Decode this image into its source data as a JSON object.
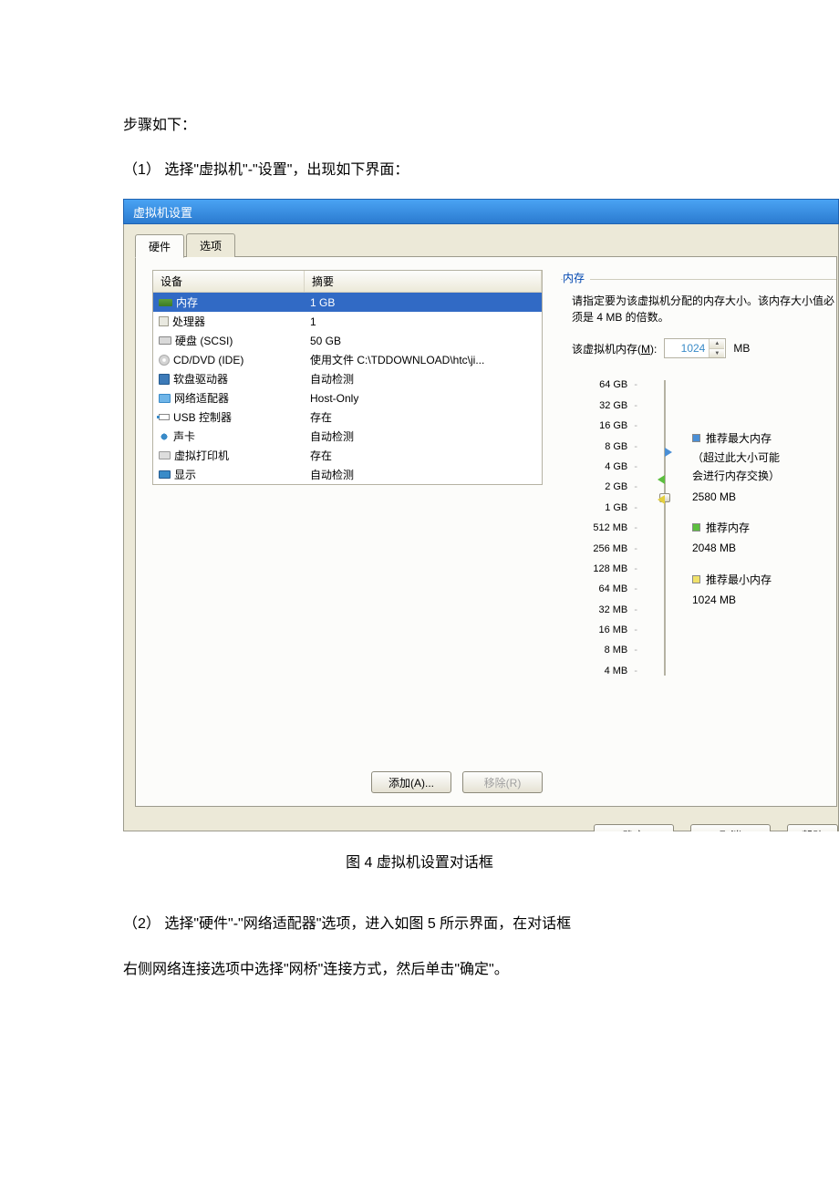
{
  "doc": {
    "line0": "步骤如下：",
    "line1": "（1） 选择\"虚拟机\"-\"设置\"，出现如下界面：",
    "caption": "图 4  虚拟机设置对话框",
    "line2": "（2） 选择\"硬件\"-\"网络适配器\"选项，进入如图 5 所示界面，在对话框",
    "line3": "右侧网络连接选项中选择\"网桥\"连接方式，然后单击\"确定\"。"
  },
  "dialog": {
    "title": "虚拟机设置",
    "tabs": {
      "hardware": "硬件",
      "options": "选项"
    },
    "columns": {
      "device": "设备",
      "summary": "摘要"
    },
    "rows": [
      {
        "icon": "mem",
        "device": "内存",
        "summary": "1 GB",
        "selected": true
      },
      {
        "icon": "cpu",
        "device": "处理器",
        "summary": "1"
      },
      {
        "icon": "hdd",
        "device": "硬盘 (SCSI)",
        "summary": "50 GB"
      },
      {
        "icon": "cd",
        "device": "CD/DVD (IDE)",
        "summary": "使用文件 C:\\TDDOWNLOAD\\htc\\ji..."
      },
      {
        "icon": "floppy",
        "device": "软盘驱动器",
        "summary": "自动检测"
      },
      {
        "icon": "net",
        "device": "网络适配器",
        "summary": "Host-Only"
      },
      {
        "icon": "usb",
        "device": "USB 控制器",
        "summary": "存在"
      },
      {
        "icon": "sound",
        "device": "声卡",
        "summary": "自动检测"
      },
      {
        "icon": "printer",
        "device": "虚拟打印机",
        "summary": "存在"
      },
      {
        "icon": "display",
        "device": "显示",
        "summary": "自动检测"
      }
    ],
    "buttons": {
      "add": "添加(A)...",
      "remove": "移除(R)",
      "ok": "确定",
      "cancel": "取消",
      "help": "帮助"
    },
    "memory": {
      "group_title": "内存",
      "desc": "请指定要为该虚拟机分配的内存大小。该内存大小值必须是 4 MB 的倍数。",
      "label_prefix": "该虚拟机内存(",
      "label_mnemonic": "M",
      "label_suffix": "):",
      "value": "1024",
      "unit": "MB",
      "ticks": [
        "64 GB",
        "32 GB",
        "16 GB",
        "8 GB",
        "4 GB",
        "2 GB",
        "1 GB",
        "512 MB",
        "256 MB",
        "128 MB",
        "64 MB",
        "32 MB",
        "16 MB",
        "8 MB",
        "4 MB"
      ],
      "legend": {
        "max_label": "推荐最大内存",
        "max_note1": "（超过此大小可能",
        "max_note2": "会进行内存交换）",
        "max_value": "2580 MB",
        "rec_label": "推荐内存",
        "rec_value": "2048 MB",
        "min_label": "推荐最小内存",
        "min_value": "1024 MB"
      }
    }
  }
}
